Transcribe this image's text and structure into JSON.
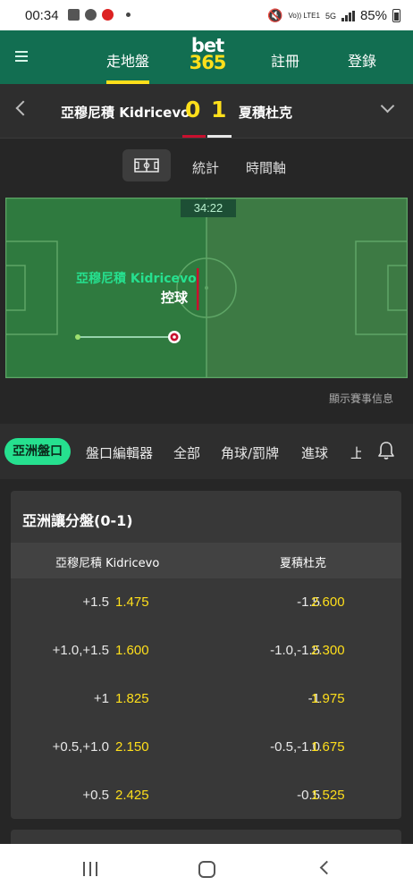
{
  "status_bar": {
    "time": "00:34",
    "network": "5G",
    "volte": "Vo)) LTE1",
    "battery": "85%"
  },
  "header": {
    "live_label": "走地盤",
    "logo_top": "bet",
    "logo_bottom": "365",
    "register_label": "註冊",
    "login_label": "登錄",
    "accent": "#126e51",
    "highlight": "#ffdf1b"
  },
  "match": {
    "home_team": "亞穆尼積 Kidricevo",
    "home_score": "0",
    "away_score": "1",
    "away_team": "夏積杜克"
  },
  "view_tabs": {
    "pitch_icon": "pitch-icon",
    "stats": "統計",
    "timeline": "時間軸"
  },
  "pitch": {
    "clock": "34:22",
    "possession_team": "亞穆尼積 Kidricevo",
    "possession_label": "控球",
    "show_info": "顯示賽事信息"
  },
  "market_tabs": {
    "active": "亞洲盤口",
    "items": [
      "盤口編輯器",
      "全部",
      "角球/罰牌",
      "進球",
      "上"
    ],
    "bell_icon": "bell-icon"
  },
  "odds_card": {
    "title": "亞洲讓分盤(0-1)",
    "home_header": "亞穆尼積 Kidricevo",
    "away_header": "夏積杜克",
    "rows": [
      {
        "home_line": "+1.5",
        "home_price": "1.475",
        "away_line": "-1.5",
        "away_price": "2.600"
      },
      {
        "home_line": "+1.0,+1.5",
        "home_price": "1.600",
        "away_line": "-1.0,-1.5",
        "away_price": "2.300"
      },
      {
        "home_line": "+1",
        "home_price": "1.825",
        "away_line": "-1",
        "away_price": "1.975"
      },
      {
        "home_line": "+0.5,+1.0",
        "home_price": "2.150",
        "away_line": "-0.5,-1.0",
        "away_price": "1.675"
      },
      {
        "home_line": "+0.5",
        "home_price": "2.425",
        "away_line": "-0.5",
        "away_price": "1.525"
      }
    ]
  }
}
